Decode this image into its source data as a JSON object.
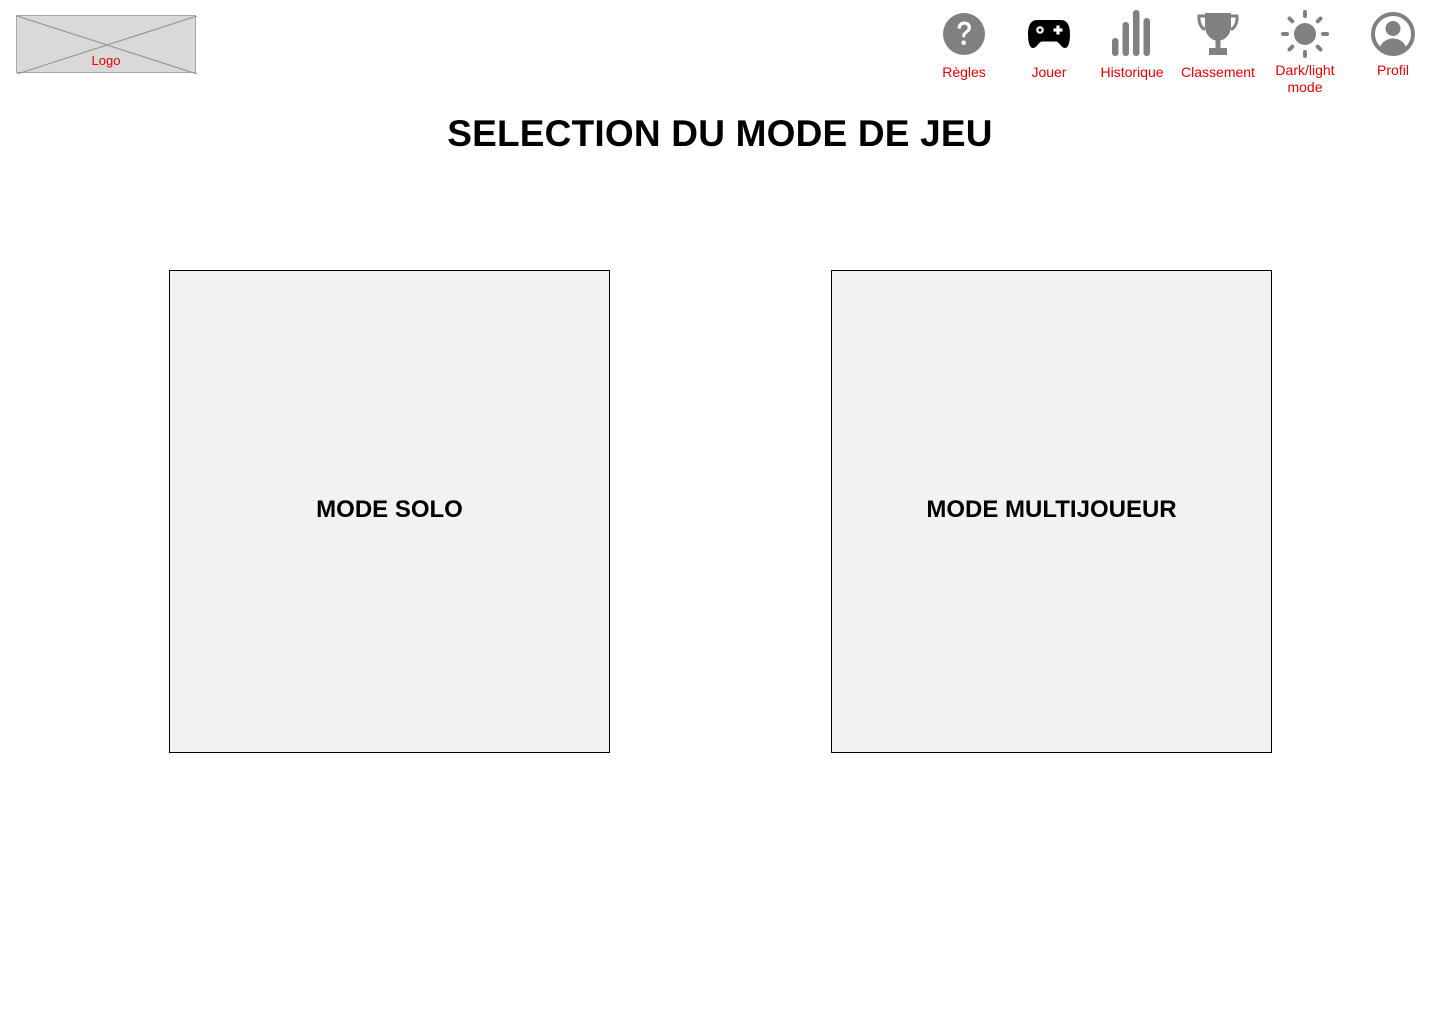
{
  "header": {
    "logo_label": "Logo",
    "nav": [
      {
        "label": "Règles",
        "icon": "help-icon"
      },
      {
        "label": "Jouer",
        "icon": "gamepad-icon"
      },
      {
        "label": "Historique",
        "icon": "bar-chart-icon"
      },
      {
        "label": "Classement",
        "icon": "trophy-icon"
      },
      {
        "label": "Dark/light mode",
        "icon": "sun-icon"
      },
      {
        "label": "Profil",
        "icon": "user-circle-icon"
      }
    ]
  },
  "main": {
    "title": "SELECTION DU MODE DE JEU",
    "modes": [
      {
        "label": "MODE SOLO"
      },
      {
        "label": "MODE MULTIJOUEUR"
      }
    ]
  },
  "colors": {
    "nav_label": "#e60000",
    "icon_gray": "#808080",
    "icon_active": "#000000",
    "card_bg": "#f2f2f2"
  }
}
